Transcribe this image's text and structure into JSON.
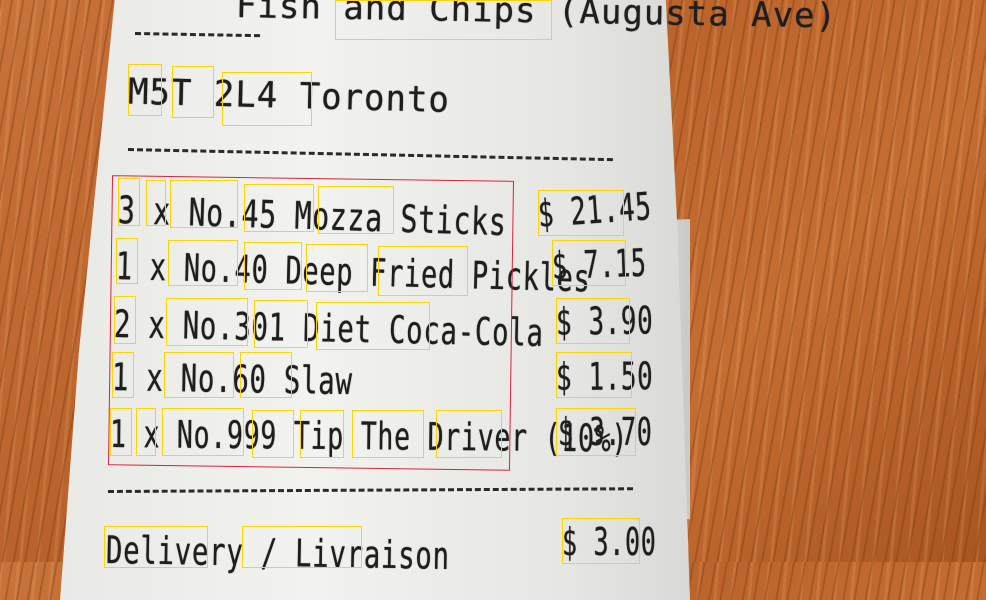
{
  "receipt": {
    "header_partial": "Fish and Chips (Augusta Ave)",
    "postal_city": "M5T 2L4 Toronto",
    "items": [
      {
        "desc": "3 x No.45 Mozza Sticks",
        "price": "$ 21.45"
      },
      {
        "desc": "1 x No.40 Deep Fried Pickles",
        "price": "$ 7.15"
      },
      {
        "desc": "2 x No.301 Diet Coca-Cola",
        "price": "$ 3.90"
      },
      {
        "desc": "1 x No.60 Slaw",
        "price": "$ 1.50"
      },
      {
        "desc": "1 x No.999 Tip The Driver (10%)",
        "price": "$ 3.70"
      }
    ],
    "delivery_label": "Delivery / Livraison",
    "delivery_price": "$ 3.00"
  },
  "colors": {
    "table": "#c06a30",
    "paper": "#efefec",
    "ink": "#1e1e1e",
    "word_box": "#ffd400",
    "region_box": "#e0203a"
  }
}
